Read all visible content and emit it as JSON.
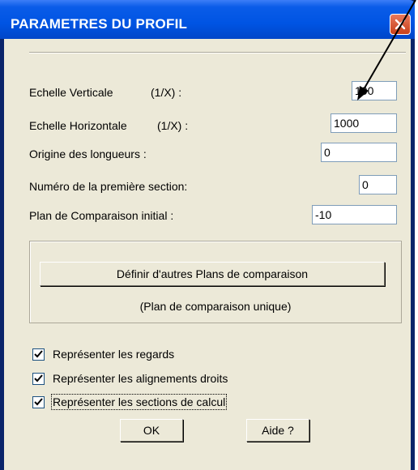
{
  "window": {
    "title": "PARAMETRES DU PROFIL"
  },
  "fields": [
    {
      "label": "Echelle Verticale",
      "unit": "(1/X) :",
      "value": "100"
    },
    {
      "label": "Echelle Horizontale",
      "unit": "(1/X) :",
      "value": "1000"
    },
    {
      "label": "Origine des longueurs :",
      "value": "0"
    },
    {
      "label": "Numéro de la première section:",
      "value": "0"
    },
    {
      "label": "Plan de Comparaison initial  :",
      "value": "-10"
    }
  ],
  "group": {
    "button_label": "Définir d'autres Plans de comparaison",
    "status_text": "(Plan de comparaison unique)"
  },
  "checkboxes": [
    {
      "label": "Représenter les regards",
      "checked": true
    },
    {
      "label": "Représenter les alignements droits",
      "checked": true
    },
    {
      "label": "Représenter les sections de calcul",
      "checked": true
    }
  ],
  "buttons": {
    "ok": "OK",
    "help": "Aide ?"
  },
  "icons": {
    "close": "close-icon",
    "check": "check-icon"
  },
  "colors": {
    "titlebar": "#0054e3",
    "dialog_bg": "#ece9d8",
    "close_button": "#c7401a"
  }
}
